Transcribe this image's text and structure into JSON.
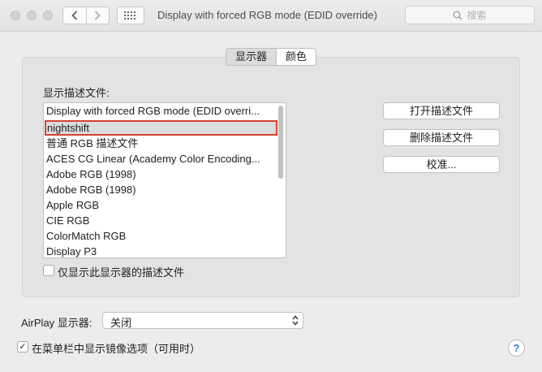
{
  "window": {
    "title": "Display with forced RGB mode (EDID override)",
    "search_placeholder": "搜索"
  },
  "tabs": [
    {
      "label": "显示器",
      "selected": true
    },
    {
      "label": "颜色",
      "selected": false
    }
  ],
  "profiles": {
    "section_label": "显示描述文件:",
    "items": [
      "Display with forced RGB mode (EDID overri...",
      "nightshift",
      "普通 RGB 描述文件",
      "ACES CG Linear (Academy Color Encoding...",
      "Adobe RGB (1998)",
      "Adobe RGB (1998)",
      "Apple RGB",
      "CIE RGB",
      "ColorMatch RGB",
      "Display P3"
    ],
    "selected_index": 1,
    "only_this_display_label": "仅显示此显示器的描述文件",
    "only_this_display_checked": false
  },
  "buttons": {
    "open_profile": "打开描述文件",
    "delete_profile": "删除描述文件",
    "calibrate": "校准..."
  },
  "airplay": {
    "label": "AirPlay 显示器:",
    "value": "关闭"
  },
  "mirror_option": {
    "label": "在菜单栏中显示镜像选项（可用时）",
    "checked": true,
    "check_glyph": "✓"
  },
  "help_label": "?",
  "colors": {
    "selection_outline": "#d6412f",
    "selection_fill": "#dcdcdc",
    "help_blue": "#3b7bd6"
  }
}
